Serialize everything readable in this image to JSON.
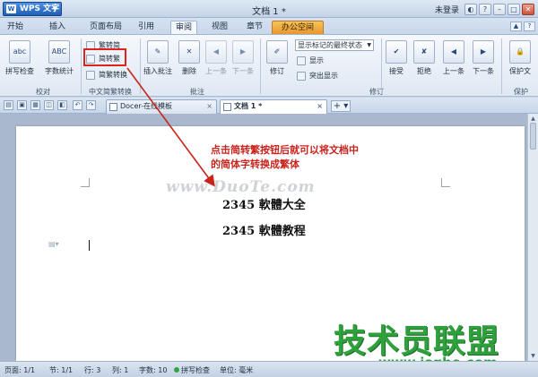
{
  "titlebar": {
    "app_menu": "WPS 文字",
    "window_title": "文档 1 *",
    "login_label": "未登录"
  },
  "ribbon_tabs": [
    "开始",
    "插入",
    "页面布局",
    "引用",
    "审阅",
    "视图",
    "章节",
    "办公空间"
  ],
  "active_tab": "审阅",
  "ribbon": {
    "proofing": {
      "spell_check": "拼写检查",
      "word_count": "字数统计",
      "group_label": "校对"
    },
    "chinese_conversion": {
      "trad_to_simp": "繁转简",
      "simp_to_trad": "简转繁",
      "simp_trad_convert": "简繁转换",
      "group_label": "中文简繁转换"
    },
    "comments": {
      "insert_comment": "插入批注",
      "delete": "删除",
      "previous": "上一条",
      "next": "下一条",
      "group_label": "批注"
    },
    "tracking": {
      "track_changes": "修订",
      "display_mode": "显示标记的最终状态",
      "show": "显示",
      "highlight_show": "突出显示",
      "group_label": "修订"
    },
    "changes": {
      "accept": "接受",
      "reject": "拒绝",
      "previous": "上一条",
      "next": "下一条"
    },
    "protect": {
      "protect_doc": "保护文",
      "group_label": "保护"
    }
  },
  "doc_tabs": [
    {
      "label": "Docer-在线模板",
      "active": false
    },
    {
      "label": "文档 1 *",
      "active": true
    }
  ],
  "document": {
    "annotation_line1": "点击简转繁按钮后就可以将文档中",
    "annotation_line2": "的简体字转换成繁体",
    "watermark": "www.DuoTe.com",
    "line1": "2345 軟體大全",
    "line2": "2345 軟體教程"
  },
  "watermark_brand": {
    "text": "技术员联盟",
    "url": "www.jsgho.com"
  },
  "statusbar": {
    "page": "页面: 1/1",
    "section": "节: 1/1",
    "line": "行: 3",
    "column": "列: 1",
    "word_count": "字数: 10",
    "spell_check": "拼写检查",
    "unit": "单位: 毫米"
  },
  "colors": {
    "annotation_red": "#c9231c",
    "watermark_green": "#2ea13c",
    "office_tab": "#e7962d"
  }
}
